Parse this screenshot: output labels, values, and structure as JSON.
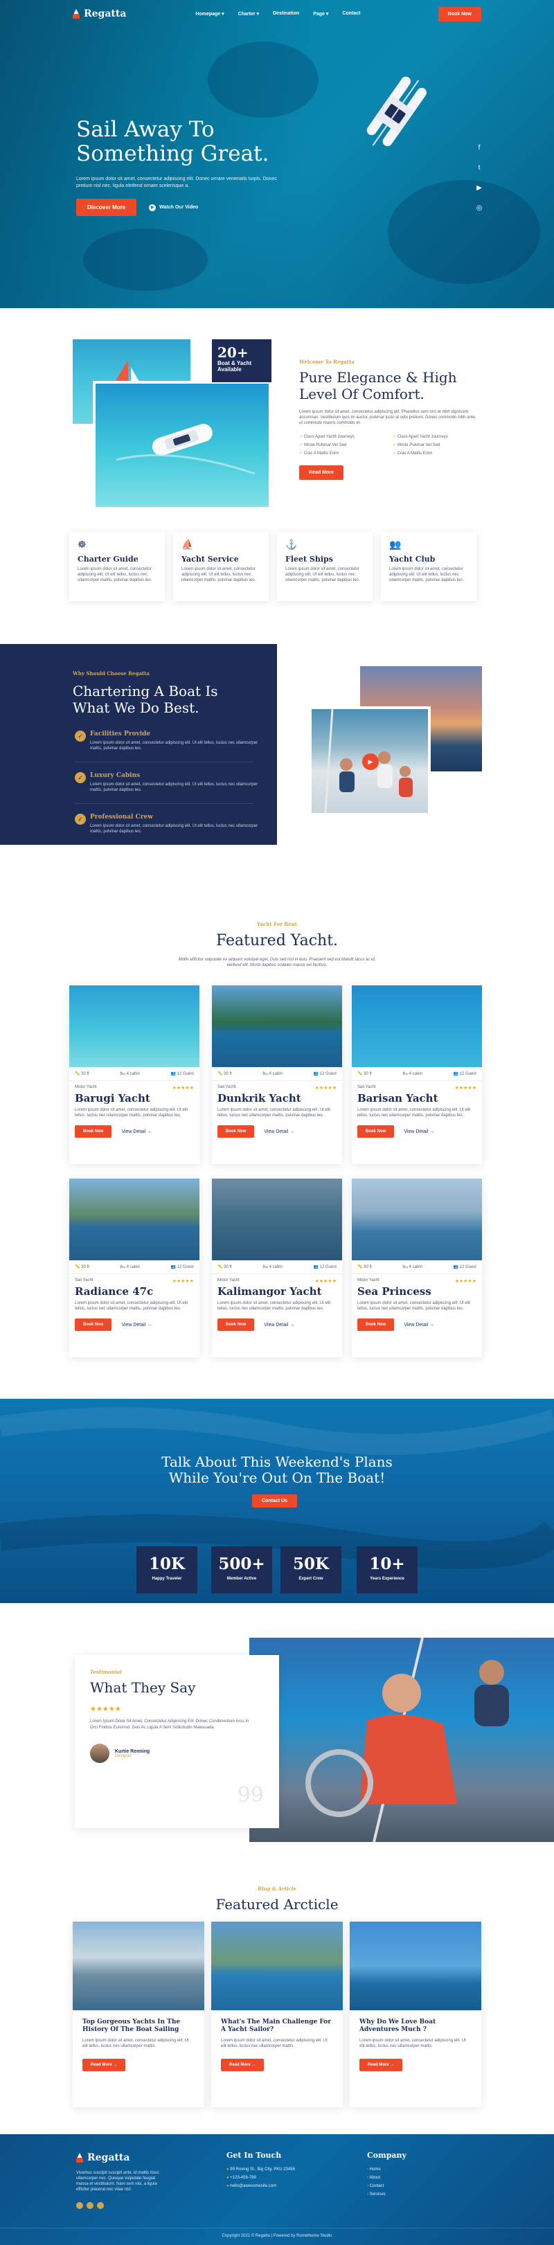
{
  "colors": {
    "navy": "#1c2c57",
    "accent": "#ee4a2a",
    "gold": "#d8a44a",
    "ocean": "#0a87b0"
  },
  "nav": {
    "brand": "Regatta",
    "items": [
      "Homepage",
      "Charter",
      "Destination",
      "Page",
      "Contact"
    ],
    "cta": "Book Now"
  },
  "hero": {
    "title_line1": "Sail Away To",
    "title_line2": "Something Great.",
    "text": "Lorem ipsum dolor sit amet, consectetur adipiscing elit. Donec ornare venenatis turpis. Donec pretium nisl nec, ligula eleifend ornare scelerisque a.",
    "primary_button": "Discover More",
    "video_link": "Watch Our Video",
    "social_icons": [
      "facebook-icon",
      "twitter-icon",
      "youtube-icon",
      "instagram-icon"
    ]
  },
  "about": {
    "badge_number": "20+",
    "badge_text": "Boat & Yacht Available",
    "eyebrow": "Welcome To Regatta",
    "title_line1": "Pure Elegance & High",
    "title_line2": "Level Of Comfort.",
    "text": "Lorem ipsum dolor sit amet, consectetur adipiscing elit. Phasellus sem orci et nibh dignissim accumsan. Vestibulum quis mi auctor, pulvinar justo at odio pretium. Donec commodo nibh ante, ut commodo mauris commodo et.",
    "checklist": [
      "Class Apart Yacht Journeys",
      "Class Apart Yacht Journeys",
      "Wrote Pulvinar Vel Sed",
      "Wrote Pulvinar Vel Sed",
      "Cras A Mattis Enim",
      "Cras A Mattis Enim"
    ],
    "button": "Read More"
  },
  "features": [
    {
      "title": "Charter Guide",
      "text": "Lorem ipsum dolor sit amet, consectetur adipiscing elit. Ut elit tellus, luctus nec ullamcorper mattis, pulvinar dapibus leo."
    },
    {
      "title": "Yacht Service",
      "text": "Lorem ipsum dolor sit amet, consectetur adipiscing elit. Ut elit tellus, luctus nec ullamcorper mattis, pulvinar dapibus leo."
    },
    {
      "title": "Fleet Ships",
      "text": "Lorem ipsum dolor sit amet, consectetur adipiscing elit. Ut elit tellus, luctus nec ullamcorper mattis, pulvinar dapibus leo."
    },
    {
      "title": "Yacht Club",
      "text": "Lorem ipsum dolor sit amet, consectetur adipiscing elit. Ut elit tellus, luctus nec ullamcorper mattis, pulvinar dapibus leo."
    }
  ],
  "why": {
    "eyebrow": "Why Should Choose Regatta",
    "title_line1": "Chartering A Boat Is",
    "title_line2": "What We Do Best.",
    "items": [
      {
        "title": "Facilities Provide",
        "text": "Lorem ipsum dolor sit amet, consectetur adipiscing elit. Ut elit tellus, luctus nec ullamcorper mattis, pulvinar dapibus leo."
      },
      {
        "title": "Luxury Cabins",
        "text": "Lorem ipsum dolor sit amet, consectetur adipiscing elit. Ut elit tellus, luctus nec ullamcorper mattis, pulvinar dapibus leo."
      },
      {
        "title": "Professional Crew",
        "text": "Lorem ipsum dolor sit amet, consectetur adipiscing elit. Ut elit tellus, luctus nec ullamcorper mattis, pulvinar dapibus leo."
      }
    ]
  },
  "featured": {
    "eyebrow": "Yacht For Rent",
    "title": "Featured Yacht.",
    "subtitle": "Mollis efficitur vulputate ex aliquam volutpat eget. Duis sed nisl in duis. Praesent sed est blandit lacus ac id, eleifend elit. Morbi dapibus sodales massa vel facilisis.",
    "cards": [
      {
        "length": "30 ft",
        "cabins": "4 cabin",
        "guests": "12 Guest",
        "type": "Motor Yacht",
        "stars": "★★★★★",
        "name": "Barugi Yacht",
        "text": "Lorem ipsum dolor sit amet, consectetur adipiscing elit. Ut elit tellus, luctus nec ullamcorper mattis, pulvinar dapibus leo.",
        "book": "Book Now",
        "view": "View Detail"
      },
      {
        "length": "30 ft",
        "cabins": "4 cabin",
        "guests": "12 Guest",
        "type": "Sail Yacht",
        "stars": "★★★★★",
        "name": "Dunkrik Yacht",
        "text": "Lorem ipsum dolor sit amet, consectetur adipiscing elit. Ut elit tellus, luctus nec ullamcorper mattis, pulvinar dapibus leo.",
        "book": "Book Now",
        "view": "View Detail"
      },
      {
        "length": "30 ft",
        "cabins": "4 cabin",
        "guests": "12 Guest",
        "type": "Sail Yacht",
        "stars": "★★★★★",
        "name": "Barisan Yacht",
        "text": "Lorem ipsum dolor sit amet, consectetur adipiscing elit. Ut elit tellus, luctus nec ullamcorper mattis, pulvinar dapibus leo.",
        "book": "Book Now",
        "view": "View Detail"
      },
      {
        "length": "30 ft",
        "cabins": "4 cabin",
        "guests": "12 Guest",
        "type": "Sail Yacht",
        "stars": "★★★★★",
        "name": "Radiance 47c",
        "text": "Lorem ipsum dolor sit amet, consectetur adipiscing elit. Ut elit tellus, luctus nec ullamcorper mattis, pulvinar dapibus leo.",
        "book": "Book Now",
        "view": "View Detail"
      },
      {
        "length": "30 ft",
        "cabins": "4 cabin",
        "guests": "12 Guest",
        "type": "Motor Yacht",
        "stars": "★★★★★",
        "name": "Kalimangor Yacht",
        "text": "Lorem ipsum dolor sit amet, consectetur adipiscing elit. Ut elit tellus, luctus nec ullamcorper mattis, pulvinar dapibus leo.",
        "book": "Book Now",
        "view": "View Detail"
      },
      {
        "length": "30 ft",
        "cabins": "4 cabin",
        "guests": "12 Guest",
        "type": "Motor Yacht",
        "stars": "★★★★★",
        "name": "Sea Princess",
        "text": "Lorem ipsum dolor sit amet, consectetur adipiscing elit. Ut elit tellus, luctus nec ullamcorper mattis, pulvinar dapibus leo.",
        "book": "Book Now",
        "view": "View Detail"
      }
    ]
  },
  "cta": {
    "title_line1": "Talk About This Weekend's Plans",
    "title_line2": "While You're Out On The Boat!",
    "button": "Contact Us",
    "stats": [
      {
        "value": "10K",
        "label": "Happy Traveler"
      },
      {
        "value": "500+",
        "label": "Member Active"
      },
      {
        "value": "50K",
        "label": "Expert Crew"
      },
      {
        "value": "10+",
        "label": "Years Experience"
      }
    ]
  },
  "testimonial": {
    "eyebrow": "Testimonial",
    "title": "What They Say",
    "stars": "★★★★★",
    "quote": "Lorem Ipsum Dolor Sit Amet, Consectetur Adipiscing Elit. Donec Condimentum Arcu In Orci Finibus Euismod. Duis Ac Ligula A Sem Sollicitudin Malesuada.",
    "author": "Kurtie Renning",
    "role": "Designer",
    "quote_mark": "99"
  },
  "blog": {
    "eyebrow": "Blog & Article",
    "title": "Featured Arcticle",
    "posts": [
      {
        "title": "Top Gorgeous Yachts In The History Of The Boat Sailing",
        "text": "Lorem ipsum dolor sit amet, consectetur adipiscing elit. Ut elit tellus, luctus nec ullamcorper mattis.",
        "button": "Read More →"
      },
      {
        "title": "What's The Main Challenge For A Yacht Sailor?",
        "text": "Lorem ipsum dolor sit amet, consectetur adipiscing elit. Ut elit tellus, luctus nec ullamcorper mattis.",
        "button": "Read More →"
      },
      {
        "title": "Why Do We Love Boat Adventures Much ?",
        "text": "Lorem ipsum dolor sit amet, consectetur adipiscing elit. Ut elit tellus, luctus nec ullamcorper mattis.",
        "button": "Read More →"
      }
    ]
  },
  "footer": {
    "brand": "Regatta",
    "about": "Vivamus suscipit suscipit ante, id mattis risus ullamcorper nec. Quisque vulputate feugiat massa et vestibulum. Nam sem nisi, a ligula efficitur placerat nec vitae nisl.",
    "contact_title": "Get In Touch",
    "contact": [
      "99 Roving St., Big City, PKU 23456",
      "+123-456-789",
      "hello@awesomesite.com"
    ],
    "company_title": "Company",
    "company_links": [
      "Home",
      "About",
      "Contact",
      "Services"
    ],
    "copyright": "Copyright 2022 © Regatta | Powered by Rometheme Studio"
  }
}
